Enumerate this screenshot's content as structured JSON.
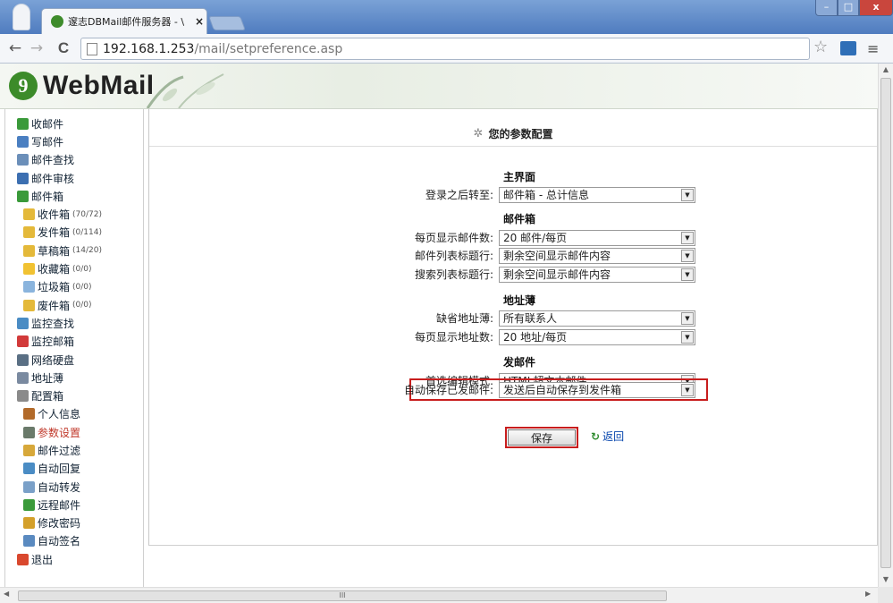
{
  "browser": {
    "tab_title": "邃志DBMail邮件服务器 - \\",
    "tab_close": "×",
    "window_min": "–",
    "window_max": "□",
    "window_close": "x",
    "url_host": "192.168.1.253",
    "url_path": "/mail/setpreference.asp",
    "back": "←",
    "forward": "→",
    "reload": "C",
    "bookmark_star": "☆",
    "menu": "≡",
    "hscroll_grip": "III"
  },
  "header": {
    "logo_text": "WebMail"
  },
  "sidebar": {
    "items": [
      {
        "label": "收邮件",
        "icon": "inbox-green-icon",
        "color": "#3a9a3a"
      },
      {
        "label": "写邮件",
        "icon": "compose-icon",
        "color": "#4a7fc1"
      },
      {
        "label": "邮件查找",
        "icon": "search-icon",
        "color": "#6b8fb9"
      },
      {
        "label": "邮件审核",
        "icon": "user-audit-icon",
        "color": "#3c6fb1"
      },
      {
        "label": "邮件箱",
        "icon": "mailbox-home-icon",
        "color": "#3a9a3a"
      },
      {
        "label": "收件箱",
        "count": "(70/72)",
        "icon": "inbox-folder-icon",
        "color": "#e4b93a"
      },
      {
        "label": "发件箱",
        "count": "(0/114)",
        "icon": "outbox-folder-icon",
        "color": "#e4b93a"
      },
      {
        "label": "草稿箱",
        "count": "(14/20)",
        "icon": "drafts-folder-icon",
        "color": "#e4b93a"
      },
      {
        "label": "收藏箱",
        "count": "(0/0)",
        "icon": "star-folder-icon",
        "color": "#f1c232"
      },
      {
        "label": "垃圾箱",
        "count": "(0/0)",
        "icon": "trash-icon",
        "color": "#8ab4dd"
      },
      {
        "label": "废件箱",
        "count": "(0/0)",
        "icon": "deleted-folder-icon",
        "color": "#e4b93a"
      },
      {
        "label": "监控查找",
        "icon": "monitor-search-icon",
        "color": "#4a8cc4"
      },
      {
        "label": "监控邮箱",
        "icon": "monitor-mailbox-icon",
        "color": "#d23a3a"
      },
      {
        "label": "网络硬盘",
        "icon": "network-disk-icon",
        "color": "#5a6f84"
      },
      {
        "label": "地址薄",
        "icon": "address-book-icon",
        "color": "#7a8aa0"
      },
      {
        "label": "配置箱",
        "icon": "tools-icon",
        "color": "#8a8a8a"
      },
      {
        "label": "个人信息",
        "icon": "person-icon",
        "color": "#b26a2a"
      },
      {
        "label": "参数设置",
        "icon": "gear-icon",
        "color": "#6a7a6a"
      },
      {
        "label": "邮件过滤",
        "icon": "filter-mail-icon",
        "color": "#d7a83a"
      },
      {
        "label": "自动回复",
        "icon": "auto-reply-icon",
        "color": "#4a8cc4"
      },
      {
        "label": "自动转发",
        "icon": "auto-forward-icon",
        "color": "#7aa0c8"
      },
      {
        "label": "远程邮件",
        "icon": "remote-mail-icon",
        "color": "#3a9a3a"
      },
      {
        "label": "修改密码",
        "icon": "lock-icon",
        "color": "#d4a02a"
      },
      {
        "label": "自动签名",
        "icon": "signature-icon",
        "color": "#5a8ac0"
      },
      {
        "label": "退出",
        "icon": "logout-icon",
        "color": "#d9482e"
      }
    ]
  },
  "main": {
    "title": "您的参数配置",
    "sections": {
      "main_ui": "主界面",
      "mailbox": "邮件箱",
      "address_book": "地址薄",
      "send_mail": "发邮件"
    },
    "fields": {
      "after_login": {
        "label": "登录之后转至:",
        "value": "邮件箱 - 总计信息"
      },
      "mails_per_page": {
        "label": "每页显示邮件数:",
        "value": "20 邮件/每页"
      },
      "mail_list_title": {
        "label": "邮件列表标题行:",
        "value": "剩余空间显示邮件内容"
      },
      "search_list_title": {
        "label": "搜索列表标题行:",
        "value": "剩余空间显示邮件内容"
      },
      "default_address_book": {
        "label": "缺省地址薄:",
        "value": "所有联系人"
      },
      "addresses_per_page": {
        "label": "每页显示地址数:",
        "value": "20 地址/每页"
      },
      "editor_mode": {
        "label": "首选编辑模式:",
        "value": "HTML超文本邮件"
      },
      "auto_save_sent": {
        "label": "自动保存已发邮件:",
        "value": "发送后自动保存到发件箱"
      }
    },
    "save_button": "保存",
    "back_link": "返回"
  }
}
